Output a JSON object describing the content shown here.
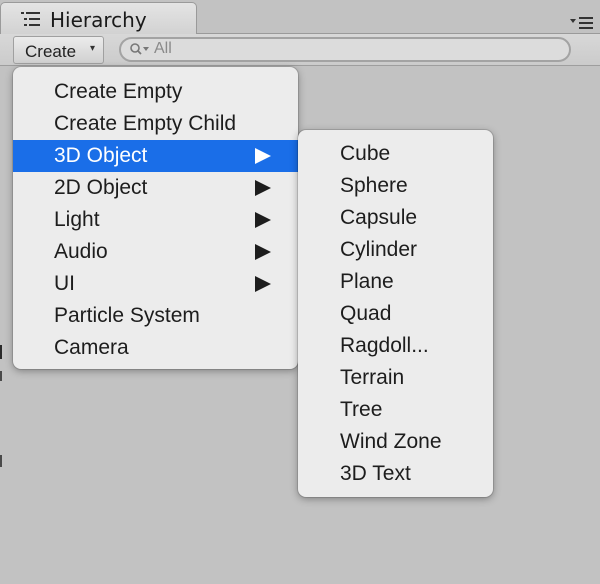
{
  "panel": {
    "title": "Hierarchy",
    "icons": {
      "tab": "hierarchy-list-icon",
      "panel_menu": "panel-menu-icon"
    }
  },
  "toolbar": {
    "create_label": "Create",
    "create_caret": "▾",
    "search_placeholder": "All",
    "search_icon": "search-icon"
  },
  "create_menu": {
    "items": [
      {
        "label": "Create Empty",
        "submenu": false
      },
      {
        "label": "Create Empty Child",
        "submenu": false
      },
      {
        "label": "3D Object",
        "submenu": true,
        "selected": true
      },
      {
        "label": "2D Object",
        "submenu": true
      },
      {
        "label": "Light",
        "submenu": true
      },
      {
        "label": "Audio",
        "submenu": true
      },
      {
        "label": "UI",
        "submenu": true
      },
      {
        "label": "Particle System",
        "submenu": false
      },
      {
        "label": "Camera",
        "submenu": false
      }
    ]
  },
  "object_3d_submenu": {
    "items": [
      {
        "label": "Cube"
      },
      {
        "label": "Sphere"
      },
      {
        "label": "Capsule"
      },
      {
        "label": "Cylinder"
      },
      {
        "label": "Plane"
      },
      {
        "label": "Quad"
      },
      {
        "label": "Ragdoll..."
      },
      {
        "label": "Terrain"
      },
      {
        "label": "Tree"
      },
      {
        "label": "Wind Zone"
      },
      {
        "label": "3D Text"
      }
    ]
  },
  "colors": {
    "selection": "#1a6ee8",
    "menu_background": "#ececec",
    "panel_background": "#c2c2c2"
  }
}
